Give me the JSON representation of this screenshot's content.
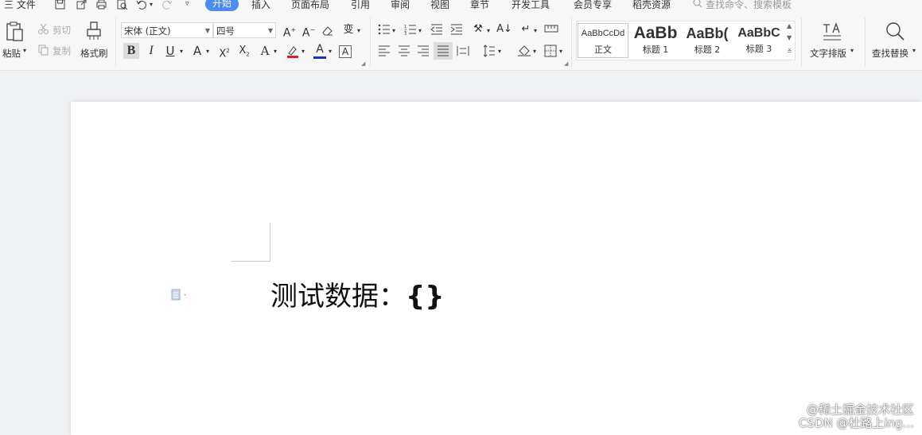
{
  "menubar": {
    "file": "三 文件",
    "tabs": [
      "开始",
      "插入",
      "页面布局",
      "引用",
      "审阅",
      "视图",
      "章节",
      "开发工具",
      "会员专享",
      "稻壳资源"
    ],
    "active_tab": "开始",
    "search_placeholder": "查找命令、搜索模板"
  },
  "ribbon": {
    "paste": "粘贴",
    "cut": "剪切",
    "copy": "复制",
    "format_painter": "格式刷",
    "font_name": "宋体 (正文)",
    "font_size": "四号",
    "styles": [
      {
        "sample": "AaBbCcDd",
        "name": "正文"
      },
      {
        "sample": "AaBb",
        "name": "标题 1"
      },
      {
        "sample": "AaBb(",
        "name": "标题 2"
      },
      {
        "sample": "AaBbC",
        "name": "标题 3"
      }
    ],
    "text_layout": "文字排版",
    "find_replace": "查找替换"
  },
  "document": {
    "text_normal": "测试数据：",
    "text_bold": "{}"
  },
  "watermark": {
    "line1": "@稀土掘金技术社区",
    "line2": "CSDN @杜路上ing..."
  },
  "colors": {
    "accent": "#4a8cf4",
    "highlight": "#e02020",
    "font_color": "#2030c0"
  }
}
